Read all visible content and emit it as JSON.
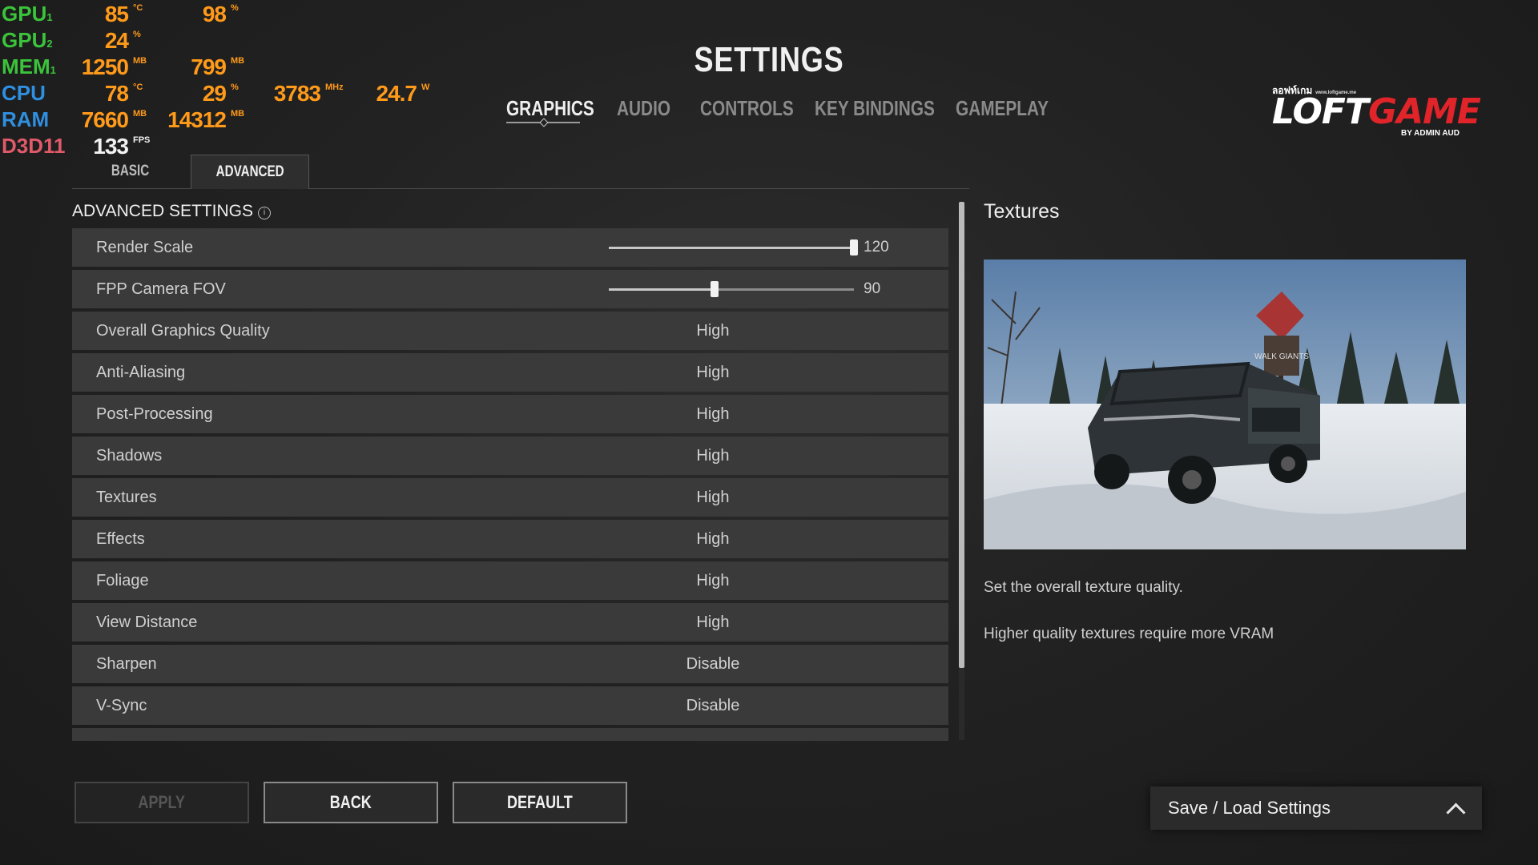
{
  "osd": {
    "rows": [
      {
        "label": "GPU1",
        "color": "#3bc43b",
        "values": [
          {
            "v": "85",
            "u": "°C"
          },
          {
            "v": "98",
            "u": "%"
          }
        ]
      },
      {
        "label": "GPU2",
        "color": "#3bc43b",
        "values": [
          {
            "v": "24",
            "u": "%"
          }
        ]
      },
      {
        "label": "MEM1",
        "color": "#3bc43b",
        "values": [
          {
            "v": "1250",
            "u": "MB"
          },
          {
            "v": "799",
            "u": "MB"
          }
        ]
      },
      {
        "label": "CPU",
        "color": "#2f8fe0",
        "values": [
          {
            "v": "78",
            "u": "°C"
          },
          {
            "v": "29",
            "u": "%"
          },
          {
            "v": "3783",
            "u": "MHz"
          },
          {
            "v": "24.7",
            "u": "W"
          }
        ]
      },
      {
        "label": "RAM",
        "color": "#2f8fe0",
        "values": [
          {
            "v": "7660",
            "u": "MB"
          },
          {
            "v": "14312",
            "u": "MB"
          }
        ]
      },
      {
        "label": "D3D11",
        "color": "#e05a6a",
        "values": [
          {
            "v": "133",
            "u": "FPS"
          }
        ]
      }
    ]
  },
  "header": {
    "title": "SETTINGS",
    "tabs": [
      "GRAPHICS",
      "AUDIO",
      "CONTROLS",
      "KEY BINDINGS",
      "GAMEPLAY"
    ],
    "active_tab": "GRAPHICS"
  },
  "logo": {
    "top_text": "ลอฟท์เกม",
    "url_text": "www.loftgame.me",
    "main_a": "LOFT",
    "main_b": "GAME",
    "sub_text": "BY ADMIN AUD"
  },
  "subtabs": {
    "basic": "BASIC",
    "advanced": "ADVANCED",
    "active": "ADVANCED"
  },
  "section": {
    "heading": "ADVANCED SETTINGS",
    "info_icon": "i"
  },
  "settings": {
    "sliders": [
      {
        "label": "Render Scale",
        "value": "120",
        "fraction": 1.0
      },
      {
        "label": "FPP Camera FOV",
        "value": "90",
        "fraction": 0.43
      }
    ],
    "options": [
      {
        "label": "Overall Graphics Quality",
        "value": "High"
      },
      {
        "label": "Anti-Aliasing",
        "value": "High"
      },
      {
        "label": "Post-Processing",
        "value": "High"
      },
      {
        "label": "Shadows",
        "value": "High"
      },
      {
        "label": "Textures",
        "value": "High"
      },
      {
        "label": "Effects",
        "value": "High"
      },
      {
        "label": "Foliage",
        "value": "High"
      },
      {
        "label": "View Distance",
        "value": "High"
      },
      {
        "label": "Sharpen",
        "value": "Disable"
      },
      {
        "label": "V-Sync",
        "value": "Disable"
      }
    ]
  },
  "description": {
    "title": "Textures",
    "line1": "Set the overall texture quality.",
    "line2": "Higher quality textures require more VRAM",
    "sign_text": "WALK GIANTS"
  },
  "buttons": {
    "apply": "APPLY",
    "back": "BACK",
    "default": "DEFAULT"
  },
  "saveload": {
    "label": "Save / Load Settings"
  }
}
